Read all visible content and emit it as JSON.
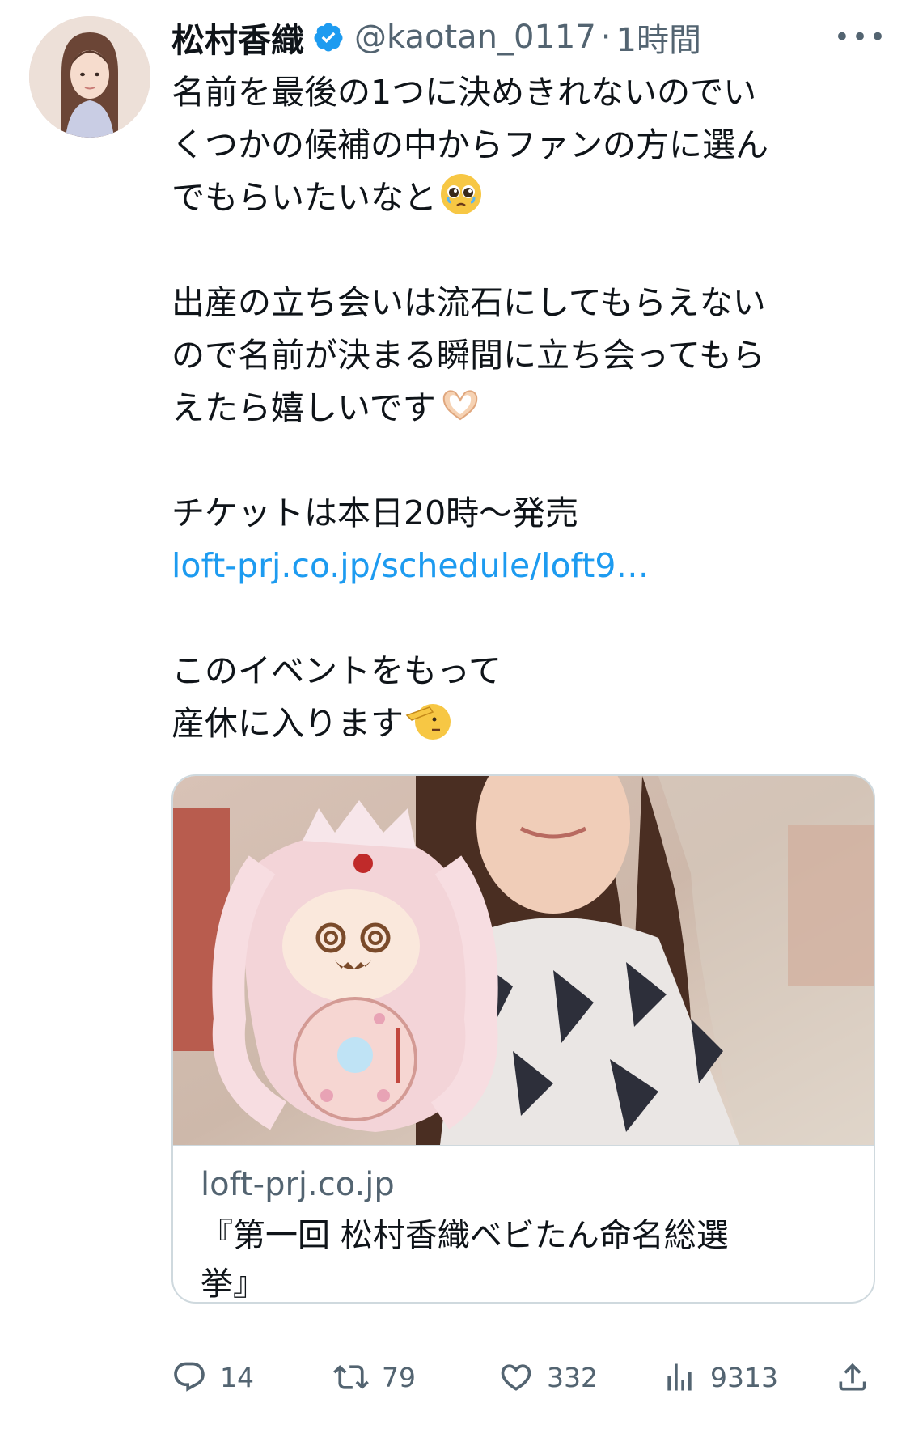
{
  "tweet": {
    "author_name": "松村香織",
    "handle": "@kaotan_0117",
    "separator": "·",
    "time": "1時間",
    "more_label": "•••",
    "lines": [
      "名前を最後の1つに決めきれないのでい",
      "くつかの候補の中からファンの方に選ん",
      "でもらいたいなと",
      "",
      "出産の立ち会いは流石にしてもらえない",
      "ので名前が決まる瞬間に立ち会ってもら",
      "えたら嬉しいです",
      "",
      "チケットは本日20時〜発売",
      "loft-prj.co.jp/schedule/loft9…",
      "",
      "このイベントをもって",
      "産休に入ります"
    ],
    "emojis": {
      "line3": "pleading-face-emoji",
      "line7": "heart-hands-emoji",
      "line13": "saluting-face-emoji"
    }
  },
  "card": {
    "domain": "loft-prj.co.jp",
    "title_line1": "『第一回 松村香織ベビたん命名総選",
    "title_line2": "挙』"
  },
  "actions": {
    "replies": "14",
    "retweets": "79",
    "likes": "332",
    "views": "9313"
  },
  "colors": {
    "link": "#1d9bf0",
    "verified": "#1d9bf0",
    "secondary_text": "#536471",
    "primary_text": "#0f1419",
    "border": "#cfd9de"
  }
}
